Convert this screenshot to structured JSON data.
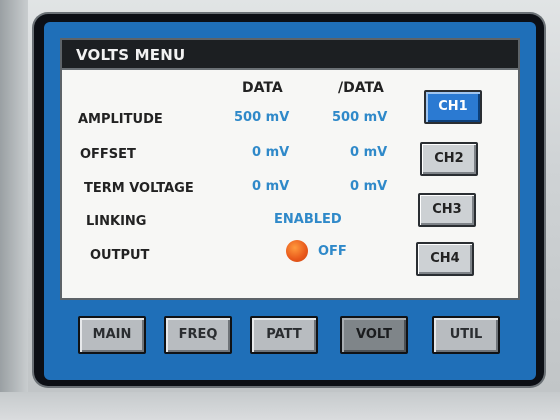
{
  "window": {
    "title": "VOLTS MENU"
  },
  "columns": {
    "data": "DATA",
    "inv_data": "/DATA"
  },
  "rows": {
    "amplitude": {
      "label": "AMPLITUDE",
      "data": "500 mV",
      "inv_data": "500 mV"
    },
    "offset": {
      "label": "OFFSET",
      "data": "0 mV",
      "inv_data": "0 mV"
    },
    "term_voltage": {
      "label": "TERM VOLTAGE",
      "data": "0 mV",
      "inv_data": "0 mV"
    },
    "linking": {
      "label": "LINKING",
      "value": "ENABLED"
    },
    "output": {
      "label": "OUTPUT",
      "value": "OFF",
      "indicator_color": "#e8571a"
    }
  },
  "channels": [
    "CH1",
    "CH2",
    "CH3",
    "CH4"
  ],
  "selected_channel": "CH1",
  "menu": [
    "MAIN",
    "FREQ",
    "PATT",
    "VOLT",
    "UTIL"
  ],
  "selected_menu": "VOLT",
  "colors": {
    "value_text": "#2f89c9",
    "screen_bg": "#1f6fb8",
    "active_channel": "#2b7ad2"
  }
}
